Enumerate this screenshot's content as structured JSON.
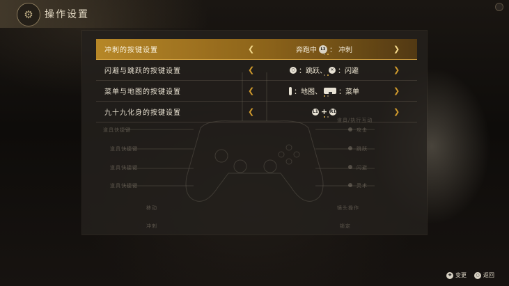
{
  "header": {
    "title": "操作设置",
    "emblem_icon": "crest-icon"
  },
  "rows": [
    {
      "label": "冲刺的按键设置",
      "value_text_1": "奔跑中",
      "value_icon_1": "L3",
      "value_sep": "：",
      "value_text_2": "冲刺",
      "active": true,
      "option_index": 1,
      "option_count": 2
    },
    {
      "label": "闪避与跳跃的按键设置",
      "value_icon_1": "circle-button",
      "value_text_1": "：跳跃、",
      "value_icon_2": "cross-button",
      "value_text_2": "：闪避",
      "active": false,
      "option_index": 1,
      "option_count": 2
    },
    {
      "label": "菜单与地图的按键设置",
      "value_icon_1": "options-button",
      "value_text_1": "：地图、",
      "value_icon_2": "touchpad-button",
      "value_text_2": "：菜单",
      "active": false,
      "option_index": 0,
      "option_count": 2
    },
    {
      "label": "九十九化身的按键设置",
      "value_icon_1": "L1",
      "value_plus": "+",
      "value_icon_2": "R1",
      "active": false,
      "option_index": 0,
      "option_count": 2
    }
  ],
  "ghost_labels": {
    "left": [
      "道具快捷键",
      "道具快捷键",
      "道具快捷键",
      "道具快捷键",
      "移动",
      "冲刺"
    ],
    "right": [
      "攻击",
      "跳跃",
      "闪避",
      "灵术",
      "镜头操作",
      "锁定"
    ],
    "right_top": "道具/执行互动"
  },
  "footer": {
    "change_icon": "dpad-icon",
    "change_label": "变更",
    "back_icon": "circle-button",
    "back_label": "返回"
  },
  "colors": {
    "accent": "#c8922a",
    "panel": "#24211d"
  }
}
